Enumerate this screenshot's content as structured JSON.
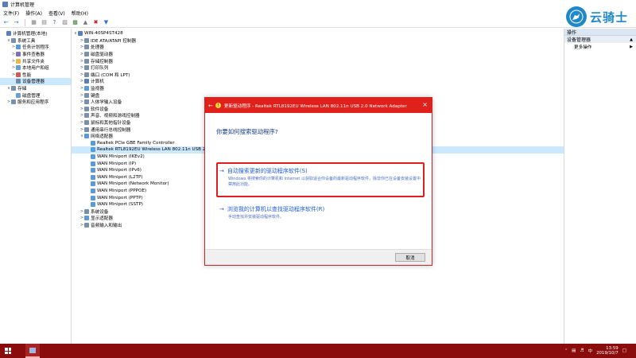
{
  "window": {
    "title": "计算机管理",
    "menu": [
      "文件(F)",
      "操作(A)",
      "查看(V)",
      "帮助(H)"
    ]
  },
  "left_tree": [
    {
      "label": "计算机管理(本地)",
      "level": 0,
      "exp": "",
      "color": "#5a7fb5"
    },
    {
      "label": "系统工具",
      "level": 1,
      "exp": "∨",
      "color": "#7a8fa8"
    },
    {
      "label": "任务计划程序",
      "level": 2,
      "exp": ">",
      "color": "#5b9bd5"
    },
    {
      "label": "事件查看器",
      "level": 2,
      "exp": ">",
      "color": "#7e6fb8"
    },
    {
      "label": "共享文件夹",
      "level": 2,
      "exp": ">",
      "color": "#e8b84a"
    },
    {
      "label": "本地用户和组",
      "level": 2,
      "exp": ">",
      "color": "#6a9fd0"
    },
    {
      "label": "性能",
      "level": 2,
      "exp": ">",
      "color": "#cc5b5b"
    },
    {
      "label": "设备管理器",
      "level": 2,
      "exp": "",
      "color": "#6f8ba8",
      "selected": true
    },
    {
      "label": "存储",
      "level": 1,
      "exp": "∨",
      "color": "#7a8fa8"
    },
    {
      "label": "磁盘管理",
      "level": 2,
      "exp": "",
      "color": "#6a9fd0"
    },
    {
      "label": "服务和应用程序",
      "level": 1,
      "exp": ">",
      "color": "#7a8fa8"
    }
  ],
  "device_tree": [
    {
      "label": "WIN-40SP4ST428",
      "level": 0,
      "exp": "∨",
      "color": "#5a7fb5"
    },
    {
      "label": "IDE ATA/ATAPI 控制器",
      "level": 1,
      "exp": ">",
      "color": "#7a8fa8"
    },
    {
      "label": "处理器",
      "level": 1,
      "exp": ">",
      "color": "#7a8fa8"
    },
    {
      "label": "磁盘驱动器",
      "level": 1,
      "exp": ">",
      "color": "#7a8fa8"
    },
    {
      "label": "存储控制器",
      "level": 1,
      "exp": ">",
      "color": "#7a8fa8"
    },
    {
      "label": "打印队列",
      "level": 1,
      "exp": ">",
      "color": "#7a8fa8"
    },
    {
      "label": "端口 (COM 和 LPT)",
      "level": 1,
      "exp": ">",
      "color": "#7a8fa8"
    },
    {
      "label": "计算机",
      "level": 1,
      "exp": ">",
      "color": "#5a7fb5"
    },
    {
      "label": "监视器",
      "level": 1,
      "exp": ">",
      "color": "#5b9bd5"
    },
    {
      "label": "键盘",
      "level": 1,
      "exp": ">",
      "color": "#7a8fa8"
    },
    {
      "label": "人体学输入设备",
      "level": 1,
      "exp": ">",
      "color": "#7a8fa8"
    },
    {
      "label": "软件设备",
      "level": 1,
      "exp": ">",
      "color": "#7a8fa8"
    },
    {
      "label": "声音、视频和游戏控制器",
      "level": 1,
      "exp": ">",
      "color": "#7a8fa8"
    },
    {
      "label": "鼠标和其他指针设备",
      "level": 1,
      "exp": ">",
      "color": "#7a8fa8"
    },
    {
      "label": "通用串行总线控制器",
      "level": 1,
      "exp": ">",
      "color": "#7a8fa8"
    },
    {
      "label": "网络适配器",
      "level": 1,
      "exp": "∨",
      "color": "#5b9bd5"
    },
    {
      "label": "Realtek PCIe GBE Family Controller",
      "level": 2,
      "exp": "",
      "color": "#5b9bd5"
    },
    {
      "label": "Realtek RTL8192EU Wireless LAN 802.11n USB 2.0 Network Adapter",
      "level": 2,
      "exp": "",
      "color": "#5b9bd5",
      "selected": true
    },
    {
      "label": "WAN Miniport (IKEv2)",
      "level": 2,
      "exp": "",
      "color": "#5b9bd5"
    },
    {
      "label": "WAN Miniport (IP)",
      "level": 2,
      "exp": "",
      "color": "#5b9bd5"
    },
    {
      "label": "WAN Miniport (IPv6)",
      "level": 2,
      "exp": "",
      "color": "#5b9bd5"
    },
    {
      "label": "WAN Miniport (L2TP)",
      "level": 2,
      "exp": "",
      "color": "#5b9bd5"
    },
    {
      "label": "WAN Miniport (Network Monitor)",
      "level": 2,
      "exp": "",
      "color": "#5b9bd5"
    },
    {
      "label": "WAN Miniport (PPPOE)",
      "level": 2,
      "exp": "",
      "color": "#5b9bd5"
    },
    {
      "label": "WAN Miniport (PPTP)",
      "level": 2,
      "exp": "",
      "color": "#5b9bd5"
    },
    {
      "label": "WAN Miniport (SSTP)",
      "level": 2,
      "exp": "",
      "color": "#5b9bd5"
    },
    {
      "label": "系统设备",
      "level": 1,
      "exp": ">",
      "color": "#7a8fa8"
    },
    {
      "label": "显示适配器",
      "level": 1,
      "exp": ">",
      "color": "#5b9bd5"
    },
    {
      "label": "音频输入和输出",
      "level": 1,
      "exp": ">",
      "color": "#7a8fa8"
    }
  ],
  "actions": {
    "header": "操作",
    "section": "设备管理器",
    "more": "更多操作"
  },
  "dialog": {
    "title": "更新驱动程序 - Realtek RTL8192EU Wireless LAN 802.11n USB 2.0 Network Adapter",
    "question": "你要如何搜索驱动程序?",
    "option1_title": "自动搜索更新的驱动程序软件(S)",
    "option1_desc": "Windows 将搜索你的计算机和 Internet 以获取适合你设备的最新驱动程序软件，除非你已在设备安装设置中禁用此功能。",
    "option2_title": "浏览我的计算机以查找驱动程序软件(R)",
    "option2_desc": "手动查找并安装驱动程序软件。",
    "cancel": "取消"
  },
  "taskbar": {
    "tray_lang": "中",
    "time": "13:59",
    "date": "2019/10/7"
  },
  "watermark": {
    "text": "云骑士"
  },
  "colors": {
    "dialog_title_bg": "#e0201a",
    "taskbar_bg": "#8b0c0c",
    "link_blue": "#1e5bd8",
    "highlight_red": "#e11d1d"
  }
}
